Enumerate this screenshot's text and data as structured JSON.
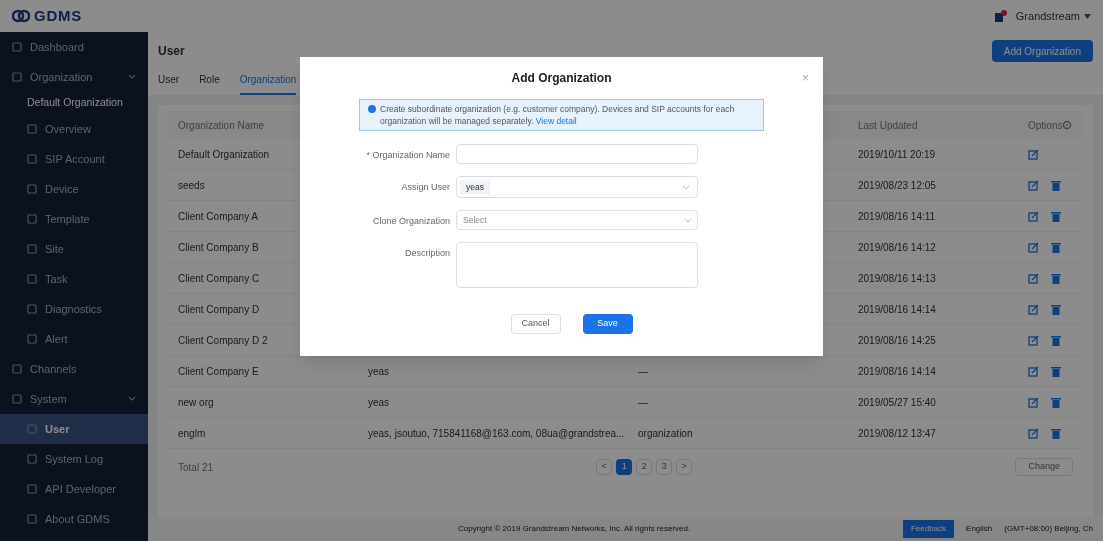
{
  "header": {
    "logo": "GDMS",
    "user": "Grandstream"
  },
  "sidebar": {
    "items": [
      {
        "label": "Dashboard",
        "selected": false
      },
      {
        "label": "Organization",
        "expanded": true,
        "selected": false,
        "children": [
          {
            "label": "Default Organization",
            "kind": "heading"
          },
          {
            "label": "Overview",
            "selected": false
          },
          {
            "label": "SIP Account",
            "selected": false
          },
          {
            "label": "Device",
            "selected": false
          },
          {
            "label": "Template",
            "selected": false
          },
          {
            "label": "Site",
            "selected": false
          },
          {
            "label": "Task",
            "selected": false
          },
          {
            "label": "Diagnostics",
            "selected": false
          },
          {
            "label": "Alert",
            "selected": false
          }
        ]
      },
      {
        "label": "Channels",
        "selected": false
      },
      {
        "label": "System",
        "expanded": true,
        "selected": false,
        "children": [
          {
            "label": "User",
            "selected": true
          },
          {
            "label": "System Log",
            "selected": false
          },
          {
            "label": "API Developer",
            "selected": false
          },
          {
            "label": "About GDMS",
            "selected": false
          }
        ]
      }
    ]
  },
  "page": {
    "title": "User",
    "add_button": "Add Organization",
    "tabs": [
      {
        "label": "User",
        "selected": false
      },
      {
        "label": "Role",
        "selected": false
      },
      {
        "label": "Organization",
        "selected": true
      }
    ],
    "table": {
      "columns": [
        "Organization Name",
        "Last Updated",
        "Options"
      ],
      "rows": [
        {
          "name": "Default Organization",
          "updated": "2019/10/11 20:19",
          "deletable": false
        },
        {
          "name": "seeds",
          "updated": "2019/08/23 12:05",
          "deletable": true
        },
        {
          "name": "Client Company A",
          "updated": "2019/08/16 14:11",
          "deletable": true
        },
        {
          "name": "Client Company B",
          "updated": "2019/08/16 14:12",
          "deletable": true
        },
        {
          "name": "Client Company C",
          "updated": "2019/08/16 14:13",
          "deletable": true
        },
        {
          "name": "Client Company D",
          "updated": "2019/08/16 14:14",
          "deletable": true
        },
        {
          "name": "Client Company D 2",
          "updated": "2019/08/16 14:25",
          "deletable": true
        },
        {
          "name": "Client Company E",
          "users": "yeas",
          "description": "—",
          "updated": "2019/08/16 14:14",
          "deletable": true
        },
        {
          "name": "new org",
          "users": "yeas",
          "description": "—",
          "updated": "2019/05/27 15:40",
          "deletable": true
        },
        {
          "name": "englm",
          "users": "yeas, jsoutuo, 715841168@163.com, 08ua@grandstrea...",
          "description": "organization",
          "updated": "2019/08/12 13:47",
          "deletable": true
        }
      ]
    },
    "total": "Total 21",
    "pagination": [
      {
        "label": "<",
        "selected": false
      },
      {
        "label": "1",
        "selected": true
      },
      {
        "label": "2",
        "selected": false
      },
      {
        "label": "3",
        "selected": false
      },
      {
        "label": ">",
        "selected": false
      }
    ],
    "change_button": "Change"
  },
  "footer": {
    "copyright": "Copyright © 2019 Grandstream Networks, Inc. All rights reserved.",
    "feedback": "Feedback",
    "language": "English",
    "timezone": "(GMT+08:00) Beijing, Ch"
  },
  "dialog": {
    "title": "Add Organization",
    "close": "×",
    "info": "Create subordinate organization (e.g. customer company). Devices and SIP accounts for each organization will be managed separately.",
    "info_link": "View detail",
    "fields": [
      {
        "label": "* Organization Name",
        "kind": "text"
      },
      {
        "label": "Assign User",
        "kind": "tags",
        "tags": [
          "yeas"
        ]
      },
      {
        "label": "Clone Organization",
        "kind": "select",
        "placeholder": "Select"
      },
      {
        "label": "Description",
        "kind": "textarea"
      }
    ],
    "buttons": [
      {
        "label": "Cancel",
        "kind": "secondary"
      },
      {
        "label": "Save",
        "kind": "primary"
      }
    ]
  }
}
